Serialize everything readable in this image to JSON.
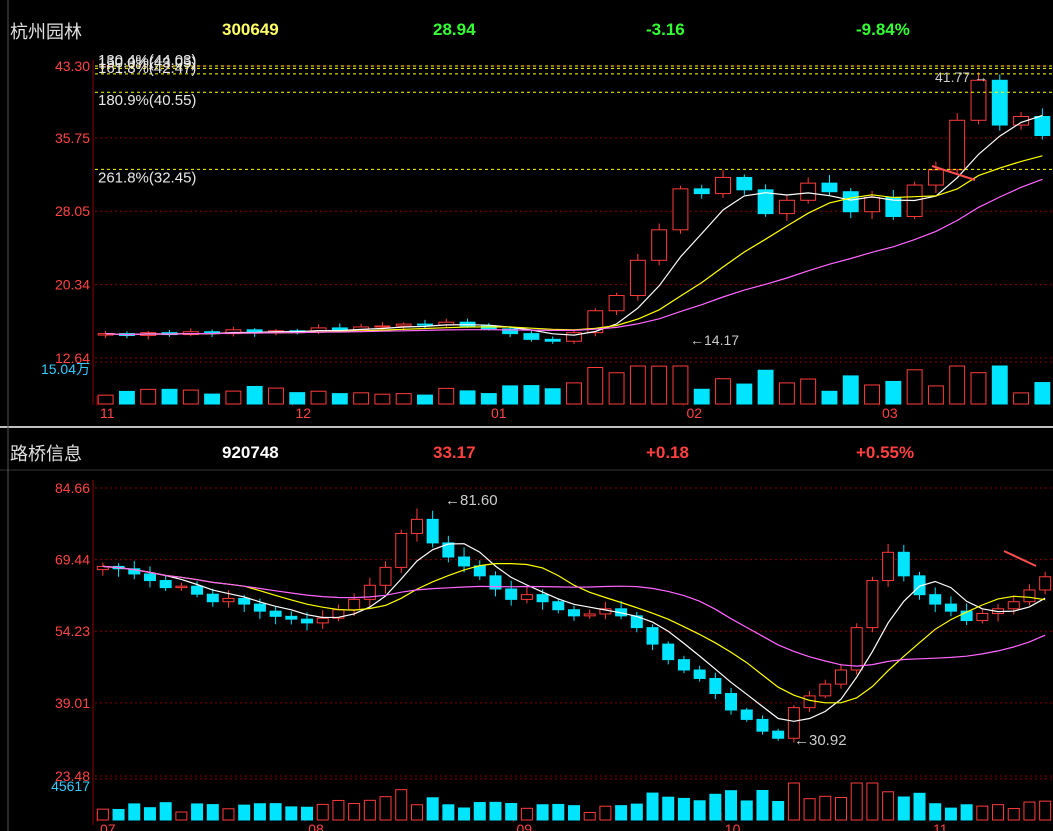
{
  "colors": {
    "background": "#000000",
    "up": "#ff3b3b",
    "down": "#00e5ff",
    "text_gold": "#ffff66",
    "text_green": "#33ff33",
    "text_red": "#ff4040",
    "axis_red": "#ff4444",
    "grid": "#8b0000",
    "fib_line": "#ffff00",
    "ma": [
      "#ffffff",
      "#ffff00",
      "#ff66ff",
      "#00ff00",
      "#00ccff",
      "#ffffaa",
      "#66cccc"
    ]
  },
  "stocks": [
    {
      "name": "杭州园林",
      "code": "300649",
      "price": "28.94",
      "change": "-3.16",
      "change_pct": "-9.84%",
      "trend": "down"
    },
    {
      "name": "路桥信息",
      "code": "920748",
      "price": "33.17",
      "change": "+0.18",
      "change_pct": "+0.55%",
      "trend": "up"
    }
  ],
  "chart_data": [
    {
      "type": "candlestick",
      "stock": "杭州园林",
      "ylim": [
        12.64,
        43.3
      ],
      "y_ticks": [
        "43.30",
        "35.75",
        "28.05",
        "20.34",
        "12.64"
      ],
      "x_ticks": [
        "11",
        "12",
        "01",
        "02",
        "03"
      ],
      "volume_label": "15.04万",
      "price_annotations": [
        "41.77",
        "14.17"
      ],
      "fib_levels": [
        {
          "label": "130.4%(44.03)",
          "value": 44.03
        },
        {
          "label": "150.0%(43.05)",
          "value": 43.05
        },
        {
          "label": "161.8%(42.47)",
          "value": 42.47
        },
        {
          "label": "180.9%(40.55)",
          "value": 40.55
        },
        {
          "label": "261.8%(32.45)",
          "value": 32.45
        }
      ],
      "series": [
        {
          "name": "",
          "kind": "close_approx",
          "values": [
            15.2,
            15.0,
            15.3,
            15.1,
            15.4,
            15.2,
            15.6,
            15.3,
            15.5,
            15.4,
            15.8,
            15.6,
            15.9,
            16.0,
            16.2,
            16.1,
            16.4,
            16.0,
            15.7,
            15.2,
            14.6,
            14.4,
            15.3,
            17.6,
            19.2,
            22.9,
            26.1,
            30.4,
            29.9,
            31.6,
            30.3,
            27.8,
            29.2,
            31.0,
            30.1,
            28.0,
            29.5,
            27.5,
            30.8,
            32.4,
            37.6,
            41.8,
            37.1,
            38.0,
            36.0
          ]
        }
      ]
    },
    {
      "type": "candlestick",
      "stock": "路桥信息",
      "ylim": [
        23.48,
        84.66
      ],
      "y_ticks": [
        "84.66",
        "69.44",
        "54.23",
        "39.01",
        "23.48"
      ],
      "x_ticks": [
        "07",
        "08",
        "09",
        "10",
        "11"
      ],
      "volume_label": "45617",
      "price_annotations": [
        "81.60",
        "30.92"
      ],
      "series": [
        {
          "name": "",
          "kind": "close_approx",
          "values": [
            68.0,
            67.5,
            66.4,
            65.0,
            63.5,
            63.8,
            62.1,
            60.5,
            61.2,
            60.0,
            58.5,
            57.4,
            56.8,
            56.0,
            57.0,
            58.8,
            61.0,
            64.0,
            67.8,
            75.0,
            78.0,
            73.0,
            70.0,
            68.1,
            66.0,
            63.2,
            61.0,
            62.0,
            60.5,
            58.8,
            57.5,
            57.9,
            59.0,
            57.5,
            55.0,
            51.5,
            48.2,
            46.0,
            44.2,
            41.0,
            37.5,
            35.5,
            33.0,
            31.5,
            38.0,
            40.5,
            43.0,
            46.0,
            55.0,
            65.0,
            71.0,
            66.0,
            62.0,
            60.0,
            58.5,
            56.5,
            58.0,
            59.0,
            60.5,
            63.0,
            65.8
          ]
        }
      ]
    }
  ]
}
